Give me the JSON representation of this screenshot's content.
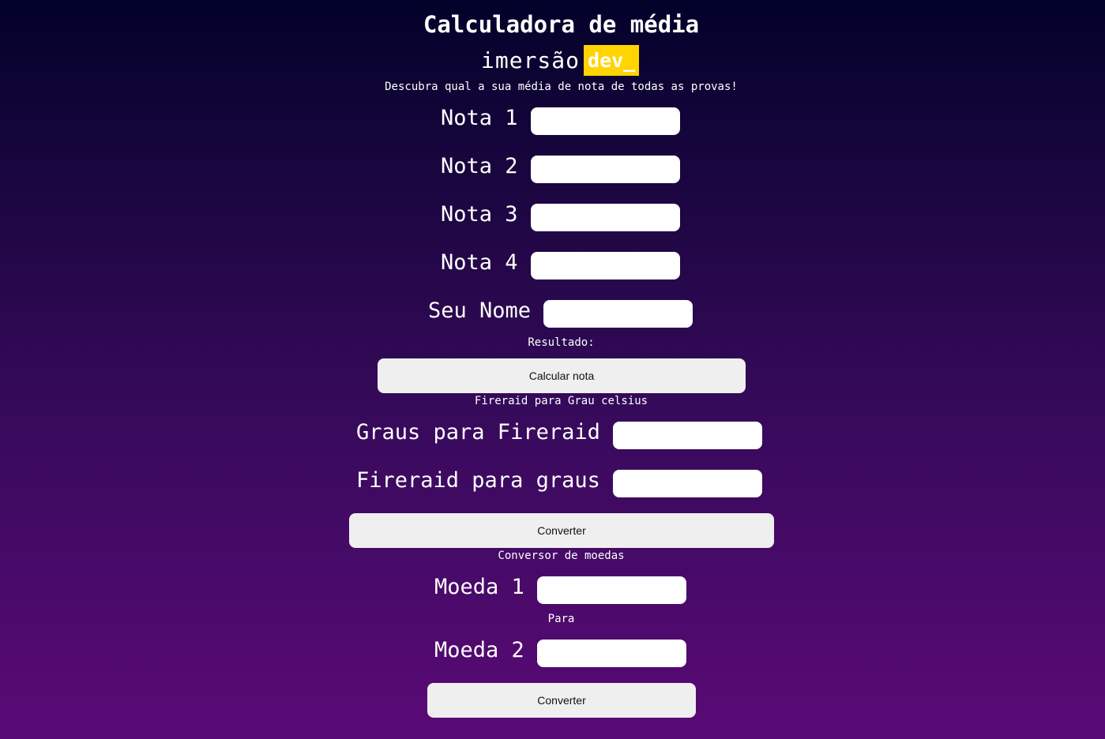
{
  "header": {
    "title": "Calculadora de média",
    "logo_text": "imersão",
    "logo_badge": "dev_",
    "subtitle": "Descubra qual a sua média de nota de todas as provas!"
  },
  "grades_section": {
    "fields": [
      {
        "label": "Nota 1",
        "value": ""
      },
      {
        "label": "Nota 2",
        "value": ""
      },
      {
        "label": "Nota 3",
        "value": ""
      },
      {
        "label": "Nota 4",
        "value": ""
      },
      {
        "label": "Seu Nome",
        "value": ""
      }
    ],
    "result_label": "Resultado:",
    "button_label": "Calcular nota"
  },
  "temperature_section": {
    "heading": "Fireraid para Grau celsius",
    "fields": [
      {
        "label": "Graus para Fireraid",
        "value": ""
      },
      {
        "label": "Fireraid para graus",
        "value": ""
      }
    ],
    "button_label": "Converter"
  },
  "currency_section": {
    "heading": "Conversor de moedas",
    "fields": [
      {
        "label": "Moeda 1",
        "value": ""
      },
      {
        "label": "Moeda 2",
        "value": ""
      }
    ],
    "separator_label": "Para",
    "button_label": "Converter"
  },
  "colors": {
    "background_top": "#02022a",
    "background_bottom": "#5a0a76",
    "logo_badge": "#ffd400",
    "button": "#efefef",
    "input": "#ffffff"
  }
}
